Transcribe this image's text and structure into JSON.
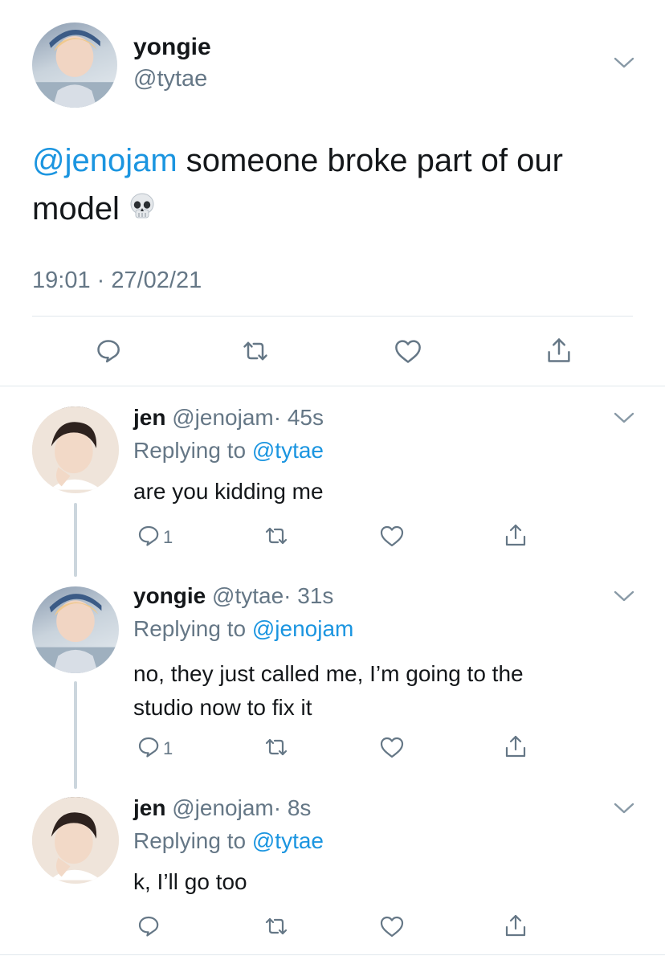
{
  "main_tweet": {
    "display_name": "yongie",
    "handle": "@tytae",
    "mention": "@jenojam",
    "text_line1": " someone broke part of our",
    "text_line2": "model",
    "emoji": "skull-emoji",
    "timestamp": "19:01 · 27/02/21"
  },
  "replies": [
    {
      "display_name": "jen",
      "handle": "@jenojam",
      "time": "· 45s",
      "replying_prefix": "Replying to ",
      "replying_to": "@tytae",
      "text_lines": [
        "are you kidding me"
      ],
      "reply_count": "1"
    },
    {
      "display_name": "yongie",
      "handle": "@tytae",
      "time": "· 31s",
      "replying_prefix": "Replying to ",
      "replying_to": "@jenojam",
      "text_lines": [
        "no, they just called me, I’m going to the",
        "studio now to fix it"
      ],
      "reply_count": "1"
    },
    {
      "display_name": "jen",
      "handle": "@jenojam",
      "time": "· 8s",
      "replying_prefix": "Replying to ",
      "replying_to": "@tytae",
      "text_lines": [
        "k, I’ll go too"
      ],
      "reply_count": ""
    }
  ],
  "colors": {
    "link": "#1b95e0",
    "muted": "#657786",
    "divider": "#e1e8ed",
    "thread_line": "#ccd6dd"
  }
}
